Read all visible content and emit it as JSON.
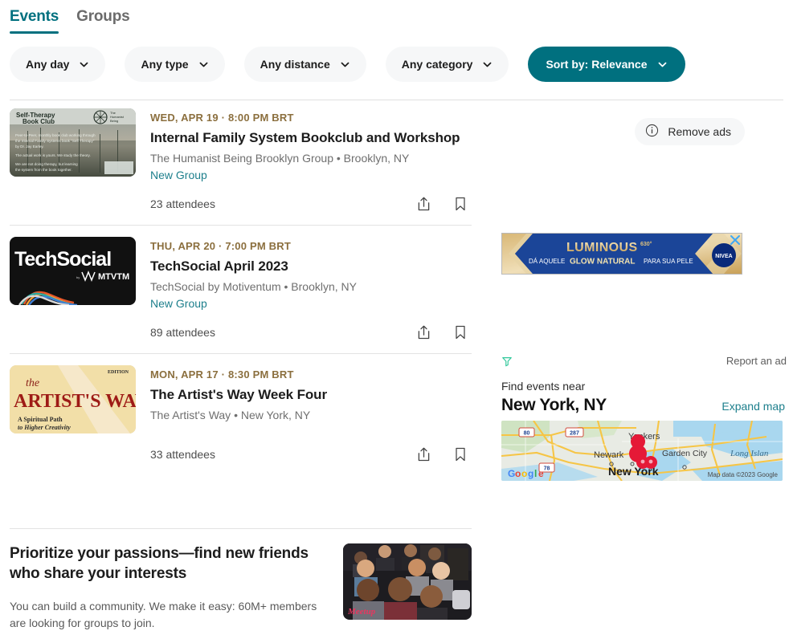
{
  "tabs": [
    {
      "label": "Events",
      "active": true
    },
    {
      "label": "Groups",
      "active": false
    }
  ],
  "filters": [
    {
      "label": "Any day",
      "icon": "chevron-down-icon",
      "primary": false
    },
    {
      "label": "Any type",
      "icon": "chevron-down-icon",
      "primary": false
    },
    {
      "label": "Any distance",
      "icon": "chevron-down-icon",
      "primary": false
    },
    {
      "label": "Any category",
      "icon": "chevron-down-icon",
      "primary": false
    },
    {
      "label": "Sort by: Relevance",
      "icon": "chevron-down-icon",
      "primary": true
    }
  ],
  "events": [
    {
      "date": "WED, APR 19 · 8:00 PM BRT",
      "title": "Internal Family System Bookclub and Workshop",
      "meta": "The Humanist Being Brooklyn Group • Brooklyn, NY",
      "badge": "New Group",
      "attendees": "23 attendees",
      "thumb_alt": "Self-Therapy Book Club",
      "thumb_title_line1": "Self-Therapy",
      "thumb_title_line2": "Book Club",
      "thumb_logo": "The Humanist Being",
      "thumb_body": "Peer-to-Peer, monthly book club working through the Internal Family Systems book \"Self Therapy\" by Dr. Jay Earley. The actual work is yours. We study the theory. We are not doing therapy, but learning the system from the book together."
    },
    {
      "date": "THU, APR 20 · 7:00 PM BRT",
      "title": "TechSocial April 2023",
      "meta": "TechSocial by Motiventum • Brooklyn, NY",
      "badge": "New Group",
      "attendees": "89 attendees",
      "thumb_alt": "TechSocial by MTVTM",
      "thumb_title_line1": "TechSocial",
      "thumb_logo": "MTVTM"
    },
    {
      "date": "MON, APR 17 · 8:30 PM BRT",
      "title": "The Artist's Way Week Four",
      "meta": "The Artist's Way • New York, NY",
      "badge": "",
      "attendees": "33 attendees",
      "thumb_alt": "The Artist's Way book cover",
      "thumb_title_line1": "the",
      "thumb_title_line2": "ARTIST'S WAY",
      "thumb_edition": "EDITION",
      "thumb_sub1": "A Spiritual Path",
      "thumb_sub2": "to Higher Creativity"
    }
  ],
  "card_actions": {
    "share_label": "Share event",
    "save_label": "Save event"
  },
  "promo": {
    "title": "Prioritize your passions—find new friends who share your interests",
    "subtitle": "You can build a community. We make it easy: 60M+ members are looking for groups to join.",
    "image_alt": "Group of smiling people posing together"
  },
  "rail": {
    "remove_ads_label": "Remove ads",
    "report_ad_label": "Report an ad",
    "near_label": "Find events near",
    "city": "New York, NY",
    "expand_map_label": "Expand map",
    "ad": {
      "brand": "NIVEA",
      "headline": "LUMINOUS",
      "headline_sup": "630°",
      "subline_1": "DÁ AQUELE",
      "subline_2": "GLOW NATURAL",
      "subline_3": "PARA SUA PELE",
      "close_label": "Close ad"
    },
    "map": {
      "attribution": "Map data ©2023 Google",
      "logo": "Google",
      "labels": [
        "Yonkers",
        "Newark",
        "Garden City",
        "Long Islan",
        "New York"
      ],
      "shields": [
        "80",
        "287",
        "78"
      ]
    }
  },
  "colors": {
    "accent_teal": "#00707f",
    "link_teal": "#1d7f8c",
    "date_gold": "#8b6f3e",
    "chip_bg": "#f6f7f8",
    "pin_red": "#e51937"
  }
}
